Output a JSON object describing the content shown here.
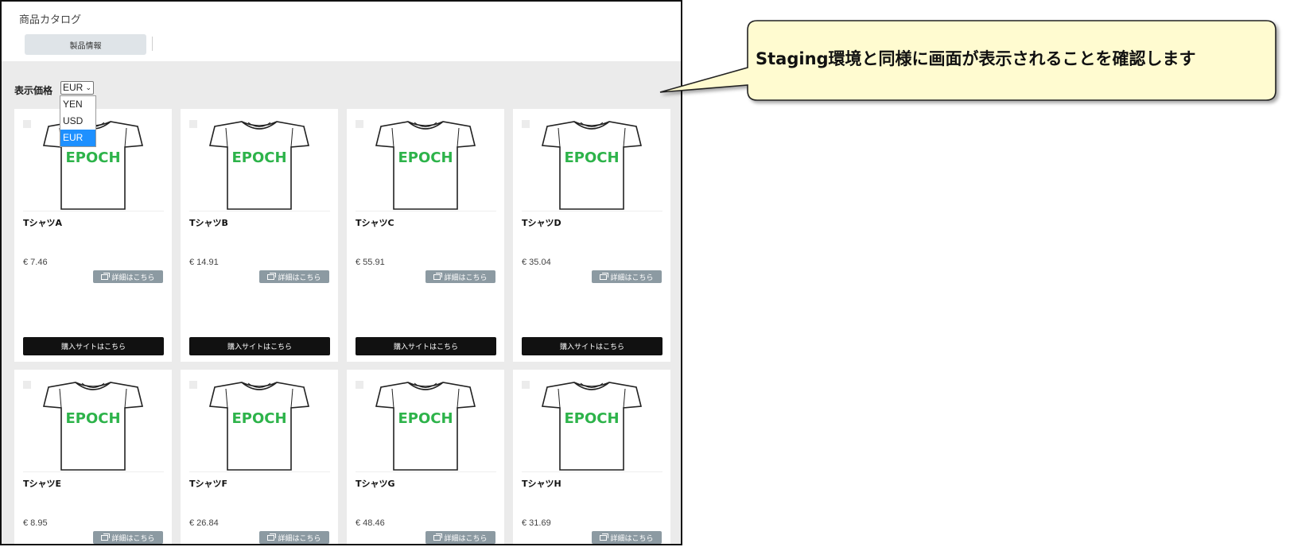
{
  "app": {
    "title": "商品カタログ",
    "tab_label": "製品情報"
  },
  "currency": {
    "label": "表示価格",
    "selected": "EUR",
    "options": [
      "YEN",
      "USD",
      "EUR"
    ]
  },
  "products": [
    {
      "name": "TシャツA",
      "price": "€ 7.46",
      "logo": "EPOCH"
    },
    {
      "name": "TシャツB",
      "price": "€ 14.91",
      "logo": "EPOCH"
    },
    {
      "name": "TシャツC",
      "price": "€ 55.91",
      "logo": "EPOCH"
    },
    {
      "name": "TシャツD",
      "price": "€ 35.04",
      "logo": "EPOCH"
    },
    {
      "name": "TシャツE",
      "price": "€ 8.95",
      "logo": "EPOCH"
    },
    {
      "name": "TシャツF",
      "price": "€ 26.84",
      "logo": "EPOCH"
    },
    {
      "name": "TシャツG",
      "price": "€ 48.46",
      "logo": "EPOCH"
    },
    {
      "name": "TシャツH",
      "price": "€ 31.69",
      "logo": "EPOCH"
    }
  ],
  "buttons": {
    "detail": "詳細はこちら",
    "buy": "購入サイトはこちら"
  },
  "callout": {
    "text": "Staging環境と同様に画面が表示されることを確認します"
  },
  "colors": {
    "logo": "#2db34a",
    "callout_fill": "#fffbd0",
    "selected_option": "#1e90ff"
  },
  "icons": [
    "checkbox-icon",
    "window-icon",
    "chevron-down-icon",
    "tshirt-image"
  ]
}
